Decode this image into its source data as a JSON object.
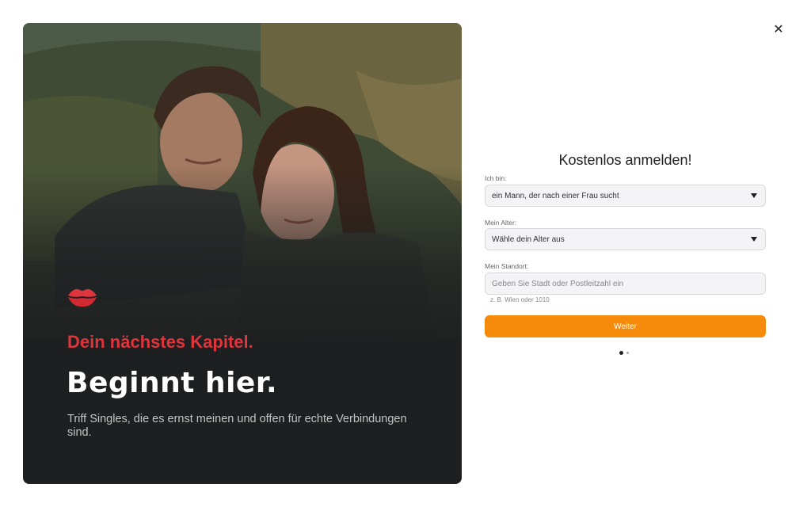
{
  "close": {
    "symbol": "✕"
  },
  "hero": {
    "photo_description_icon": "couple-selfie-photo",
    "tagline": "Dein nächstes Kapitel.",
    "headline": "Beginnt hier.",
    "subtext": "Triff Singles, die es ernst meinen und offen für echte Verbindungen sind.",
    "accent_color": "#e0343c",
    "background_color": "#1d1f20"
  },
  "form": {
    "title": "Kostenlos anmelden!",
    "gender": {
      "label": "Ich bin:",
      "value": "ein Mann, der nach einer Frau sucht"
    },
    "age": {
      "label": "Mein Alter:",
      "value": "Wähle dein Alter aus"
    },
    "location": {
      "label": "Mein Standort:",
      "placeholder": "Geben Sie Stadt oder Postleitzahl ein",
      "hint": "z. B. Wien oder 1010"
    },
    "submit_label": "Weiter",
    "submit_color": "#f68a0a",
    "step": {
      "current": 1,
      "total": 2
    }
  }
}
